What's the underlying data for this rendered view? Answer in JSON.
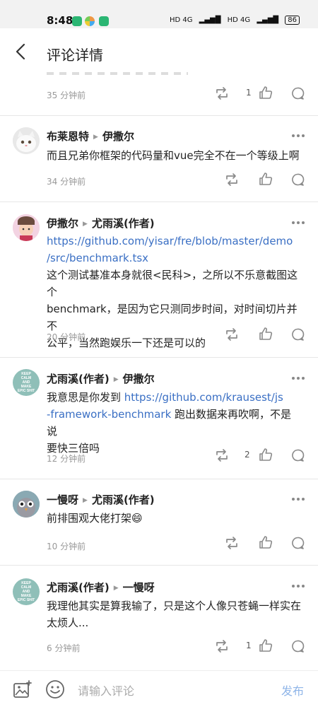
{
  "status_bar": {
    "time": "8:48",
    "signal_1": "HD 4G",
    "signal_2": "HD 4G",
    "battery": "86"
  },
  "header": {
    "title": "评论详情"
  },
  "top_item": {
    "time": "35 分钟前",
    "like_count": "1"
  },
  "comments": [
    {
      "author": "布莱恩特",
      "reply_to": "伊撒尔",
      "text": "而且兄弟你框架的代码量和vue完全不在一个等级上啊",
      "time": "34 分钟前",
      "like_count": ""
    },
    {
      "author": "伊撒尔",
      "reply_to": "尤雨溪(作者)",
      "link": "https://github.com/yisar/fre/blob/master/demo/src/benchmark.tsx",
      "link_line1": "https://github.com/yisar/fre/blob/master/demo",
      "link_line2": "/src/benchmark.tsx",
      "text_line1": "这个测试基准本身就很<民科>，之所以不乐意截图这个",
      "text_line2": "benchmark，是因为它只测同步时间，对时间切片并不",
      "text_line3": "公平，当然跑娱乐一下还是可以的",
      "time": "20 分钟前",
      "like_count": ""
    },
    {
      "author": "尤雨溪(作者)",
      "reply_to": "伊撒尔",
      "text_prefix": "我意思是你发到 ",
      "link_part1": "https://github.com/krausest/js",
      "link_part2": "-framework-benchmark",
      "text_after_link": " 跑出数据来再吹啊，不是说",
      "text_line3": "要快三倍吗",
      "time": "12 分钟前",
      "like_count": "2"
    },
    {
      "author": "一慢呀",
      "reply_to": "尤雨溪(作者)",
      "text": "前排围观大佬打架😄",
      "time": "10 分钟前",
      "like_count": ""
    },
    {
      "author": "尤雨溪(作者)",
      "reply_to": "一慢呀",
      "text_line1": "我理他其实是算我输了，只是这个人像只苍蝇一样实在",
      "text_line2": "太烦人...",
      "time": "6 分钟前",
      "like_count": "1"
    }
  ],
  "avatar_text": {
    "keep_calm_1": "KEEP",
    "keep_calm_2": "CALM",
    "keep_calm_3": "AND",
    "keep_calm_4": "MAKE",
    "keep_calm_5": "EPIC SHIT"
  },
  "composer": {
    "placeholder": "请输入评论",
    "send_label": "发布"
  },
  "colors": {
    "link": "#3a6fc4",
    "send_disabled": "#8fb5e8",
    "icon": "#8a8a8a"
  },
  "icons": {
    "back": "chevron-left-icon",
    "repost": "repost-icon",
    "like": "thumbs-up-icon",
    "comment": "comment-bubble-icon",
    "more": "more-dots-icon",
    "image": "image-add-icon",
    "emoji": "emoji-icon"
  }
}
